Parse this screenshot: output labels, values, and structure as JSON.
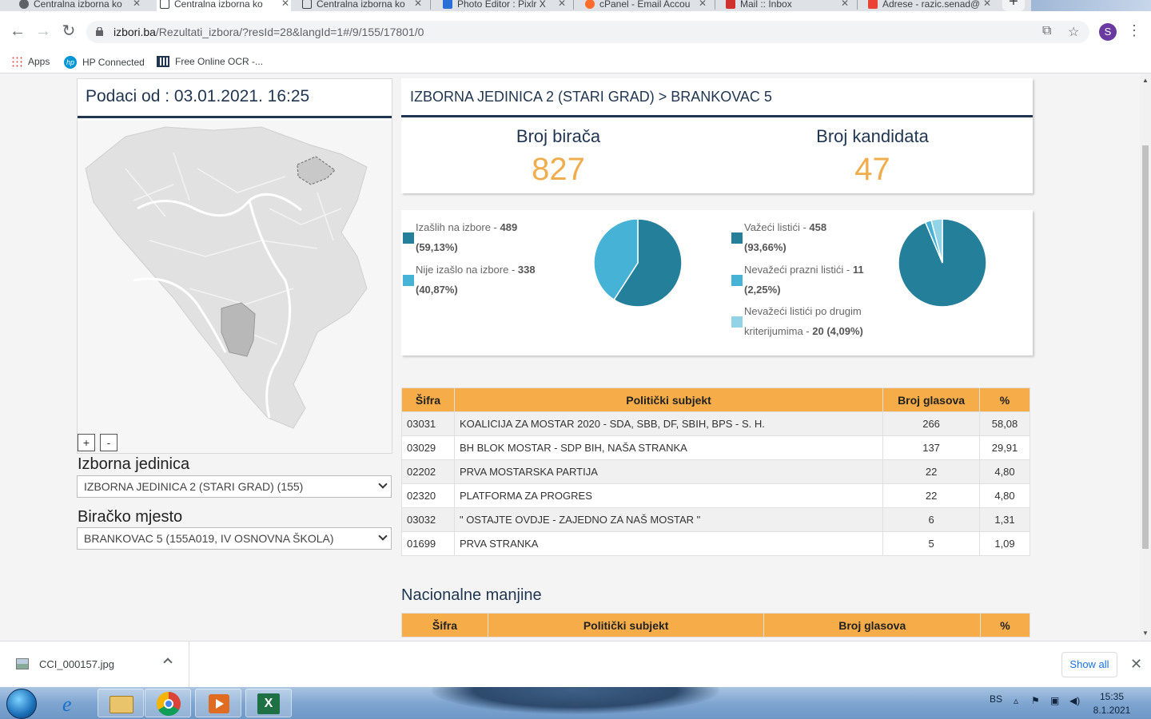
{
  "browser": {
    "tabs": [
      {
        "label": "Centralna izborna ko"
      },
      {
        "label": "Centralna izborna ko"
      },
      {
        "label": "Centralna izborna ko"
      },
      {
        "label": "Photo Editor : Pixlr X"
      },
      {
        "label": "cPanel - Email Accou"
      },
      {
        "label": "Mail :: Inbox"
      },
      {
        "label": "Adrese - razic.senad@"
      }
    ],
    "url_domain": "izbori.ba",
    "url_path": "/Rezultati_izbora/?resId=28&langId=1#/9/155/17801/0",
    "avatar_letter": "S",
    "bookmarks": [
      {
        "label": "Apps"
      },
      {
        "label": "HP Connected"
      },
      {
        "label": "Free Online OCR -..."
      }
    ]
  },
  "left": {
    "date_label": "Podaci od : 03.01.2021. 16:25",
    "zoom_in": "+",
    "zoom_out": "-",
    "unit_label": "Izborna jedinica",
    "unit_value": "IZBORNA JEDINICA 2 (STARI GRAD) (155)",
    "station_label": "Biračko mjesto",
    "station_value": "BRANKOVAC 5 (155A019, IV OSNOVNA ŠKOLA)"
  },
  "summary": {
    "title": "IZBORNA JEDINICA 2 (STARI GRAD) > BRANKOVAC 5",
    "voters_label": "Broj birača",
    "voters_value": "827",
    "candidates_label": "Broj kandidata",
    "candidates_value": "47"
  },
  "turnout": {
    "items": [
      {
        "label": "Izašlih na izbore - ",
        "value": "489",
        "pct": "(59,13%)",
        "color": "#247f9a"
      },
      {
        "label": "Nije izašlo na izbore - ",
        "value": "338",
        "pct": "(40,87%)",
        "color": "#45b2d6"
      }
    ],
    "fractions": [
      0.5913,
      0.4087
    ]
  },
  "ballots": {
    "items": [
      {
        "label": "Važeći listići - ",
        "value": "458",
        "pct": "(93,66%)",
        "color": "#247f9a"
      },
      {
        "label": "Nevažeći prazni listići - ",
        "value": "11",
        "pct": "(2,25%)",
        "color": "#45b2d6"
      },
      {
        "label": "Nevažeći listići po drugim",
        "label2": "kriterijumima - ",
        "value": "20",
        "pct": "(4,09%)",
        "color": "#92d3e6"
      }
    ],
    "fractions": [
      0.9366,
      0.0225,
      0.0409
    ]
  },
  "results": {
    "headers": [
      "Šifra",
      "Politički subjekt",
      "Broj glasova",
      "%"
    ],
    "rows": [
      {
        "code": "03031",
        "party": "KOALICIJA ZA MOSTAR 2020 - SDA, SBB, DF, SBIH, BPS - S. H.",
        "votes": "266",
        "pct": "58,08"
      },
      {
        "code": "03029",
        "party": "BH BLOK MOSTAR - SDP BIH, NAŠA STRANKA",
        "votes": "137",
        "pct": "29,91"
      },
      {
        "code": "02202",
        "party": "PRVA MOSTARSKA PARTIJA",
        "votes": "22",
        "pct": "4,80"
      },
      {
        "code": "02320",
        "party": "PLATFORMA ZA PROGRES",
        "votes": "22",
        "pct": "4,80"
      },
      {
        "code": "03032",
        "party": "\" OSTAJTE OVDJE - ZAJEDNO ZA NAŠ MOSTAR \"",
        "votes": "6",
        "pct": "1,31"
      },
      {
        "code": "01699",
        "party": "PRVA STRANKA",
        "votes": "5",
        "pct": "1,09"
      }
    ]
  },
  "minorities": {
    "title": "Nacionalne manjine",
    "headers": [
      "Šifra",
      "Politički subjekt",
      "Broj glasova",
      "%"
    ]
  },
  "downloads": {
    "file": "CCI_000157.jpg",
    "show_all": "Show all"
  },
  "taskbar": {
    "lang": "BS",
    "time": "15:35",
    "date": "8.1.2021"
  }
}
